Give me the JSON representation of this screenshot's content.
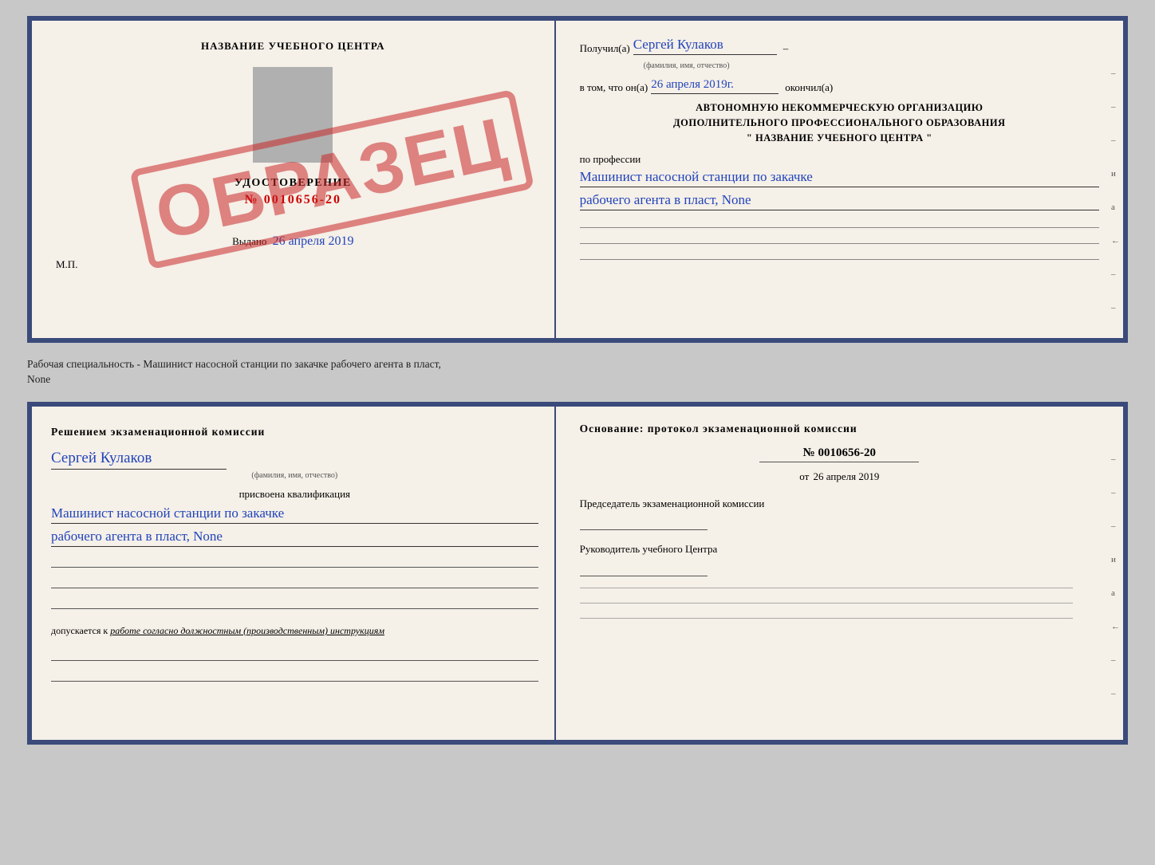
{
  "top_doc": {
    "left": {
      "title": "НАЗВАНИЕ УЧЕБНОГО ЦЕНТРА",
      "stamp_text": "ОБРАЗЕЦ",
      "udost_label": "УДОСТОВЕРЕНИЕ",
      "number": "№ 0010656-20",
      "vydano_label": "Выдано",
      "vydano_date": "26 апреля 2019",
      "mp": "М.П."
    },
    "right": {
      "poluchil_label": "Получил(а)",
      "poluchil_name": "Сергей Кулаков",
      "fio_subtext": "(фамилия, имя, отчество)",
      "vtom_label": "в том, что он(а)",
      "vtom_date": "26 апреля 2019г.",
      "okonchil_label": "окончил(а)",
      "org_text_1": "АВТОНОМНУЮ НЕКОММЕРЧЕСКУЮ ОРГАНИЗАЦИЮ",
      "org_text_2": "ДОПОЛНИТЕЛЬНОГО ПРОФЕССИОНАЛЬНОГО ОБРАЗОВАНИЯ",
      "org_quote": "\"",
      "org_name": "НАЗВАНИЕ УЧЕБНОГО ЦЕНТРА",
      "org_quote2": "\"",
      "po_professii": "по профессии",
      "profession_line1": "Машинист насосной станции по закачке",
      "profession_line2": "рабочего агента в пласт, None",
      "side_marks": [
        "-",
        "-",
        "-",
        "и",
        "а",
        "←",
        "-",
        "-",
        "-"
      ]
    }
  },
  "separator": {
    "text": "Рабочая специальность - Машинист насосной станции по закачке рабочего агента в пласт,",
    "text2": "None"
  },
  "bottom_doc": {
    "left": {
      "title": "Решением  экзаменационной  комиссии",
      "name": "Сергей Кулаков",
      "fio_subtext": "(фамилия, имя, отчество)",
      "prisvoena": "присвоена квалификация",
      "kvalif_line1": "Машинист насосной станции по закачке",
      "kvalif_line2": "рабочего агента в пласт, None",
      "dopusk_label": "допускается к",
      "dopusk_italic": "работе согласно должностным (производственным) инструкциям"
    },
    "right": {
      "osnov_title": "Основание:  протокол  экзаменационной  комиссии",
      "number": "№  0010656-20",
      "ot_label": "от",
      "ot_date": "26 апреля 2019",
      "predsedatel_label": "Председатель экзаменационной комиссии",
      "rukov_label": "Руководитель учебного Центра",
      "side_marks": [
        "-",
        "-",
        "-",
        "и",
        "а",
        "←",
        "-",
        "-",
        "-"
      ]
    }
  }
}
